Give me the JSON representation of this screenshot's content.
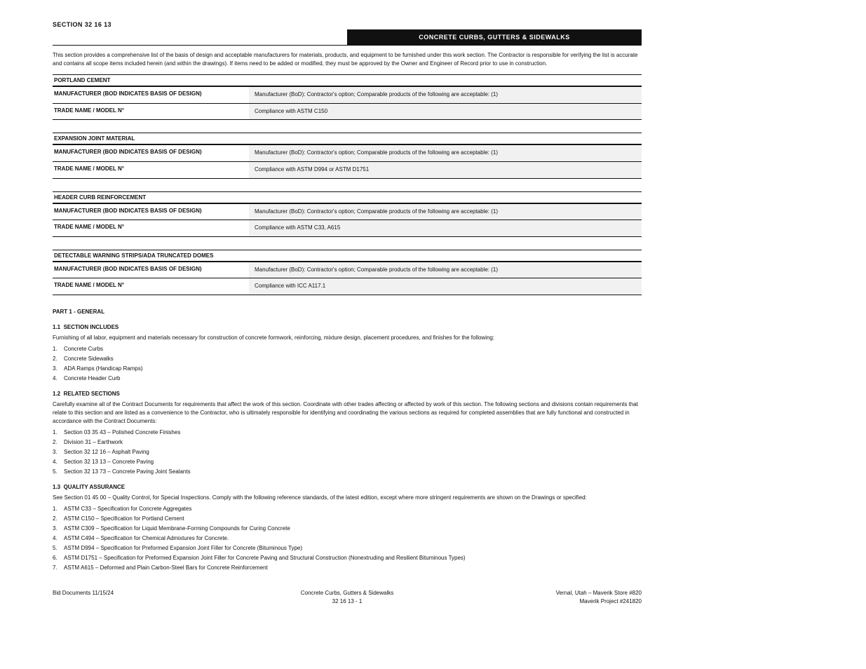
{
  "header": {
    "section_no": "SECTION 32 16 13",
    "section_title": "CONCRETE CURBS, GUTTERS & SIDEWALKS"
  },
  "intro": "This section provides a comprehensive list of the basis of design and acceptable manufacturers for materials, products, and equipment to be furnished under this work section. The Contractor is responsible for verifying the list is accurate and contains all scope items included herein (and within the drawings). If items need to be added or modified, they must be approved by the Owner and Engineer of Record prior to use in construction.",
  "groups": [
    {
      "header": "PORTLAND CEMENT",
      "rows": [
        {
          "label": "MANUFACTURER (BOD INDICATES BASIS OF DESIGN)",
          "value": "Manufacturer (BoD): Contractor's option; Comparable products of the following are acceptable: (1)"
        },
        {
          "label": "TRADE NAME / MODEL N°",
          "value": "Compliance with ASTM C150"
        }
      ]
    },
    {
      "header": "EXPANSION JOINT MATERIAL",
      "rows": [
        {
          "label": "MANUFACTURER (BOD INDICATES BASIS OF DESIGN)",
          "value": "Manufacturer (BoD): Contractor's option; Comparable products of the following are acceptable: (1)"
        },
        {
          "label": "TRADE NAME / MODEL N°",
          "value": "Compliance with ASTM D994 or ASTM D1751"
        }
      ]
    },
    {
      "header": "HEADER CURB REINFORCEMENT",
      "rows": [
        {
          "label": "MANUFACTURER (BOD INDICATES BASIS OF DESIGN)",
          "value": "Manufacturer (BoD): Contractor's option; Comparable products of the following are acceptable: (1)"
        },
        {
          "label": "TRADE NAME / MODEL N°",
          "value": "Compliance with ASTM C33, A615"
        }
      ]
    },
    {
      "header": "DETECTABLE WARNING STRIPS/ADA TRUNCATED DOMES",
      "rows": [
        {
          "label": "MANUFACTURER (BOD INDICATES BASIS OF DESIGN)",
          "value": "Manufacturer (BoD): Contractor's option; Comparable products of the following are acceptable: (1)"
        },
        {
          "label": "TRADE NAME / MODEL N°",
          "value": "Compliance with ICC A117.1"
        }
      ]
    }
  ],
  "part1": {
    "title": "PART 1 - GENERAL",
    "s11": {
      "num": "1.1",
      "title": "SECTION INCLUDES",
      "lead": "Furnishing of all labor, equipment and materials necessary for construction of concrete formwork, reinforcing, mixture design, placement procedures, and finishes for the following:",
      "items": [
        "Concrete Curbs",
        "Concrete Sidewalks",
        "ADA Ramps (Handicap Ramps)",
        "Concrete Header Curb"
      ]
    },
    "s12": {
      "num": "1.2",
      "title": "RELATED SECTIONS",
      "lead": "Carefully examine all of the Contract Documents for requirements that affect the work of this section. Coordinate with other trades affecting or affected by work of this section. The following sections and divisions contain requirements that relate to this section and are listed as a convenience to the Contractor, who is ultimately responsible for identifying and coordinating the various sections as required for completed assemblies that are fully functional and constructed in accordance with the Contract Documents:",
      "items": [
        "Section 03 35 43 – Polished Concrete Finishes",
        "Division 31 – Earthwork",
        "Section 32 12 16 – Asphalt Paving",
        "Section 32 13 13 – Concrete Paving",
        "Section 32 13 73 – Concrete Paving Joint Sealants"
      ]
    },
    "s13": {
      "num": "1.3",
      "title": "QUALITY ASSURANCE",
      "lead": "See Section 01 45 00 – Quality Control, for Special Inspections. Comply with the following reference standards, of the latest edition, except where more stringent requirements are shown on the Drawings or specified:",
      "items": [
        "ASTM C33 – Specification for Concrete Aggregates",
        "ASTM C150 – Specification for Portland Cement",
        "ASTM C309 – Specification for Liquid Membrane-Forming Compounds for Curing Concrete",
        "ASTM C494 – Specification for Chemical Admixtures for Concrete.",
        "ASTM D994 – Specification for Preformed Expansion Joint Filler for Concrete (Bituminous Type)",
        "ASTM D1751 – Specification for Preformed Expansion Joint Filler for Concrete Paving and Structural Construction (Nonextruding and Resilient Bituminous Types)",
        "ASTM A615 – Deformed and Plain Carbon-Steel Bars for Concrete Reinforcement"
      ]
    }
  },
  "footer": {
    "left": "Bid Documents 11/15/24",
    "center_line1": "Concrete Curbs, Gutters & Sidewalks",
    "center_line2": "32 16 13 - 1",
    "right_line1": "Vernal, Utah – Maverik Store #820",
    "right_line2": "Maverik Project #241820"
  }
}
